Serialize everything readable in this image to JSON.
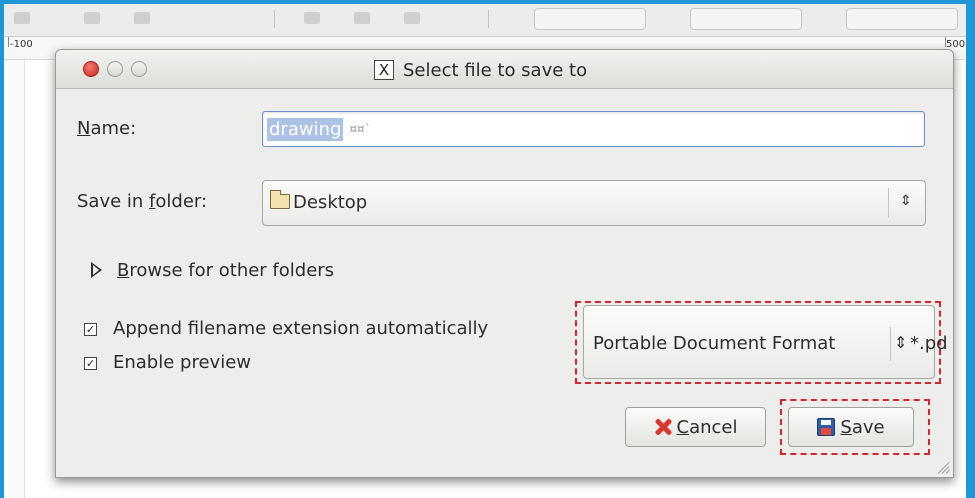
{
  "ruler": {
    "labels": [
      "-100",
      "500"
    ]
  },
  "dialog": {
    "title": "Select file to save to",
    "name_label_prefix": "N",
    "name_label_rest": "ame:",
    "name_value": "drawing",
    "name_tail": "¤¤`",
    "folder_label_prefix": "Save in ",
    "folder_label_mnemonic": "f",
    "folder_label_rest": "older:",
    "folder_value": "Desktop",
    "browse_mnemonic": "B",
    "browse_rest": "rowse for other folders",
    "append_ext_label": "Append filename extension automatically",
    "append_ext_checked": true,
    "enable_preview_label": "Enable preview",
    "enable_preview_checked": true,
    "format_value": "Portable Document Format",
    "format_tail": "*.pd",
    "cancel_mnemonic": "C",
    "cancel_rest": "ancel",
    "save_mnemonic": "S",
    "save_rest": "ave"
  },
  "colors": {
    "frame": "#1e97d6",
    "highlight": "#d9252a",
    "selection": "#adc3e6"
  }
}
